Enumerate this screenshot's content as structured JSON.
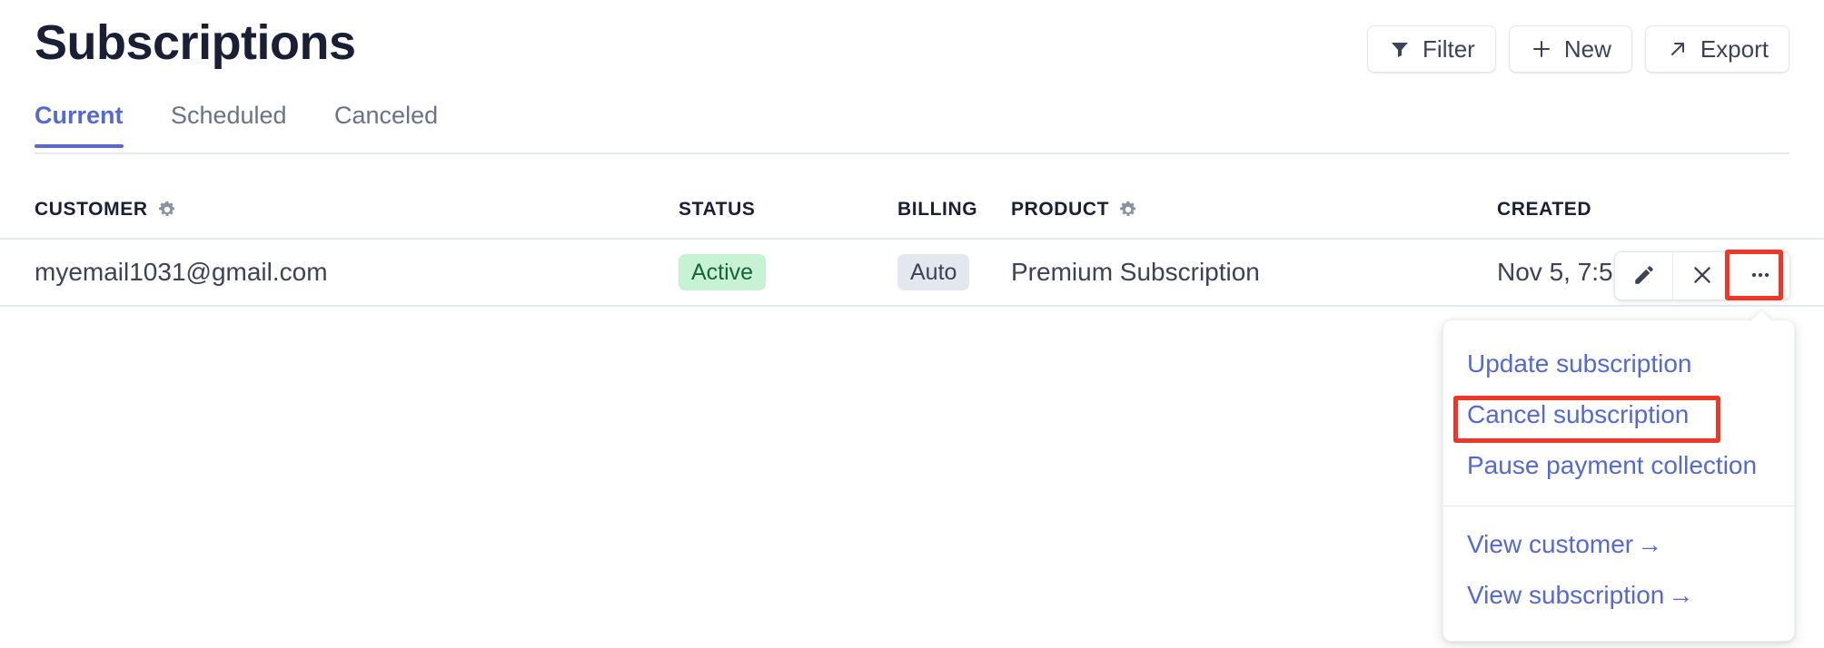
{
  "header": {
    "title": "Subscriptions",
    "actions": [
      {
        "label": "Filter",
        "icon": "filter-icon"
      },
      {
        "label": "New",
        "icon": "plus-icon"
      },
      {
        "label": "Export",
        "icon": "arrow-up-right-icon"
      }
    ]
  },
  "tabs": [
    {
      "label": "Current",
      "active": true
    },
    {
      "label": "Scheduled",
      "active": false
    },
    {
      "label": "Canceled",
      "active": false
    }
  ],
  "table": {
    "columns": [
      {
        "label": "CUSTOMER",
        "gear": true
      },
      {
        "label": "STATUS",
        "gear": false
      },
      {
        "label": "BILLING",
        "gear": false
      },
      {
        "label": "PRODUCT",
        "gear": true
      },
      {
        "label": "CREATED",
        "gear": false
      }
    ],
    "rows": [
      {
        "customer": "myemail1031@gmail.com",
        "status": "Active",
        "billing": "Auto",
        "product": "Premium Subscription",
        "created": "Nov 5, 7:5"
      }
    ]
  },
  "row_actions": [
    {
      "name": "edit",
      "icon": "pencil-icon"
    },
    {
      "name": "cancel",
      "icon": "close-icon"
    },
    {
      "name": "more",
      "icon": "ellipsis-icon"
    }
  ],
  "dropdown": {
    "primary_items": [
      "Update subscription",
      "Cancel subscription",
      "Pause payment collection"
    ],
    "link_items": [
      "View customer",
      "View subscription"
    ],
    "link_arrow": "→"
  },
  "colors": {
    "accent": "#5469d4",
    "title": "#1a1f36",
    "muted": "#697386",
    "border": "#e6e9ec",
    "badge_active_bg": "#c8f2d4",
    "badge_active_text": "#14663a",
    "badge_auto_bg": "#e3e8ee",
    "badge_auto_text": "#3c4257",
    "highlight": "#f03627"
  }
}
